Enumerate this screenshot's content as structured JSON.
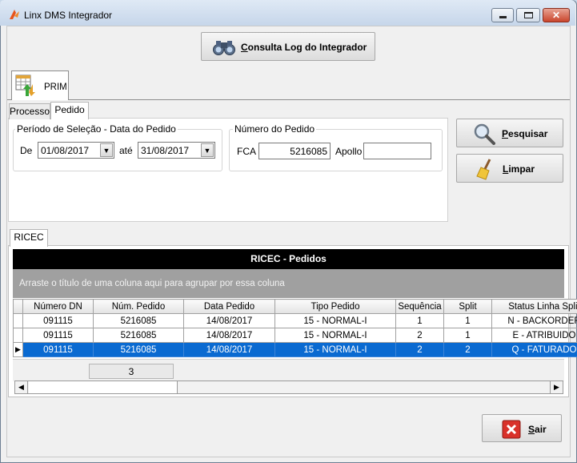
{
  "window": {
    "title": "Linx DMS Integrador"
  },
  "toolbar": {
    "log_button_label": "Consulta Log do Integrador",
    "log_button_underline": "C",
    "log_button_rest": "onsulta Log do Integrador"
  },
  "module_tab": {
    "label": "PRIM"
  },
  "filter_tabs": [
    "Processo",
    "Pedido"
  ],
  "period": {
    "title": "Período de Seleção - Data do Pedido",
    "from_label": "De",
    "from_value": "01/08/2017",
    "to_label": "até",
    "to_value": "31/08/2017"
  },
  "order_number": {
    "title": "Número do Pedido",
    "fca_label": "FCA",
    "fca_value": "5216085",
    "apollo_label": "Apollo",
    "apollo_value": ""
  },
  "actions": {
    "search_u": "P",
    "search_rest": "esquisar",
    "clear_u": "L",
    "clear_rest": "impar",
    "exit_u": "S",
    "exit_rest": "air"
  },
  "results_tab": {
    "label": "RICEC"
  },
  "grid": {
    "title": "RICEC - Pedidos",
    "group_hint": "Arraste o título de uma coluna aqui para agrupar por essa coluna",
    "columns": [
      "Número DN",
      "Núm. Pedido",
      "Data Pedido",
      "Tipo Pedido",
      "Sequência",
      "Split",
      "Status Linha Split"
    ],
    "rows": [
      [
        "091115",
        "5216085",
        "14/08/2017",
        "15 - NORMAL-I",
        "1",
        "1",
        "N - BACKORDER"
      ],
      [
        "091115",
        "5216085",
        "14/08/2017",
        "15 - NORMAL-I",
        "2",
        "1",
        "E - ATRIBUIDO"
      ],
      [
        "091115",
        "5216085",
        "14/08/2017",
        "15 - NORMAL-I",
        "2",
        "2",
        "Q - FATURADO"
      ]
    ],
    "selected_row": 2,
    "count": "3"
  },
  "colors": {
    "selection": "#0a6ad1",
    "grid_title_bg": "#000000",
    "group_panel_bg": "#a0a0a0"
  }
}
